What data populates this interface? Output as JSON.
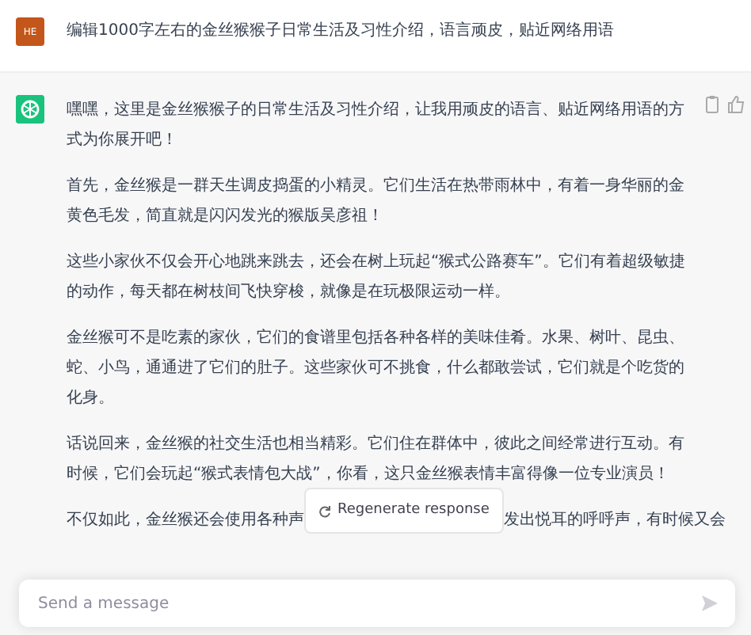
{
  "user_message": {
    "avatar": "HE",
    "text": "编辑1000字左右的金丝猴猴子日常生活及习性介绍，语言顽皮，贴近网络用语"
  },
  "assistant_message": {
    "paragraphs": [
      "嘿嘿，这里是金丝猴猴子的日常生活及习性介绍，让我用顽皮的语言、贴近网络用语的方式为你展开吧！",
      "首先，金丝猴是一群天生调皮捣蛋的小精灵。它们生活在热带雨林中，有着一身华丽的金黄色毛发，简直就是闪闪发光的猴版吴彦祖！",
      "这些小家伙不仅会开心地跳来跳去，还会在树上玩起“猴式公路赛车”。它们有着超级敏捷的动作，每天都在树枝间飞快穿梭，就像是在玩极限运动一样。",
      "金丝猴可不是吃素的家伙，它们的食谱里包括各种各样的美味佳肴。水果、树叶、昆虫、蛇、小鸟，通通进了它们的肚子。这些家伙可不挑食，什么都敢尝试，它们就是个吃货的化身。",
      "话说回来，金丝猴的社交生活也相当精彩。它们住在群体中，彼此之间经常进行互动。有时候，它们会玩起“猴式表情包大战”，你看，这只金丝猴表情丰富得像一位专业演员！"
    ],
    "last_paragraph_visible": [
      "不仅如此，金丝猴还会使用各种声",
      "发出悦耳的呼呼声，有时候又会"
    ]
  },
  "regenerate_button": "Regenerate response",
  "composer": {
    "placeholder": "Send a message"
  }
}
